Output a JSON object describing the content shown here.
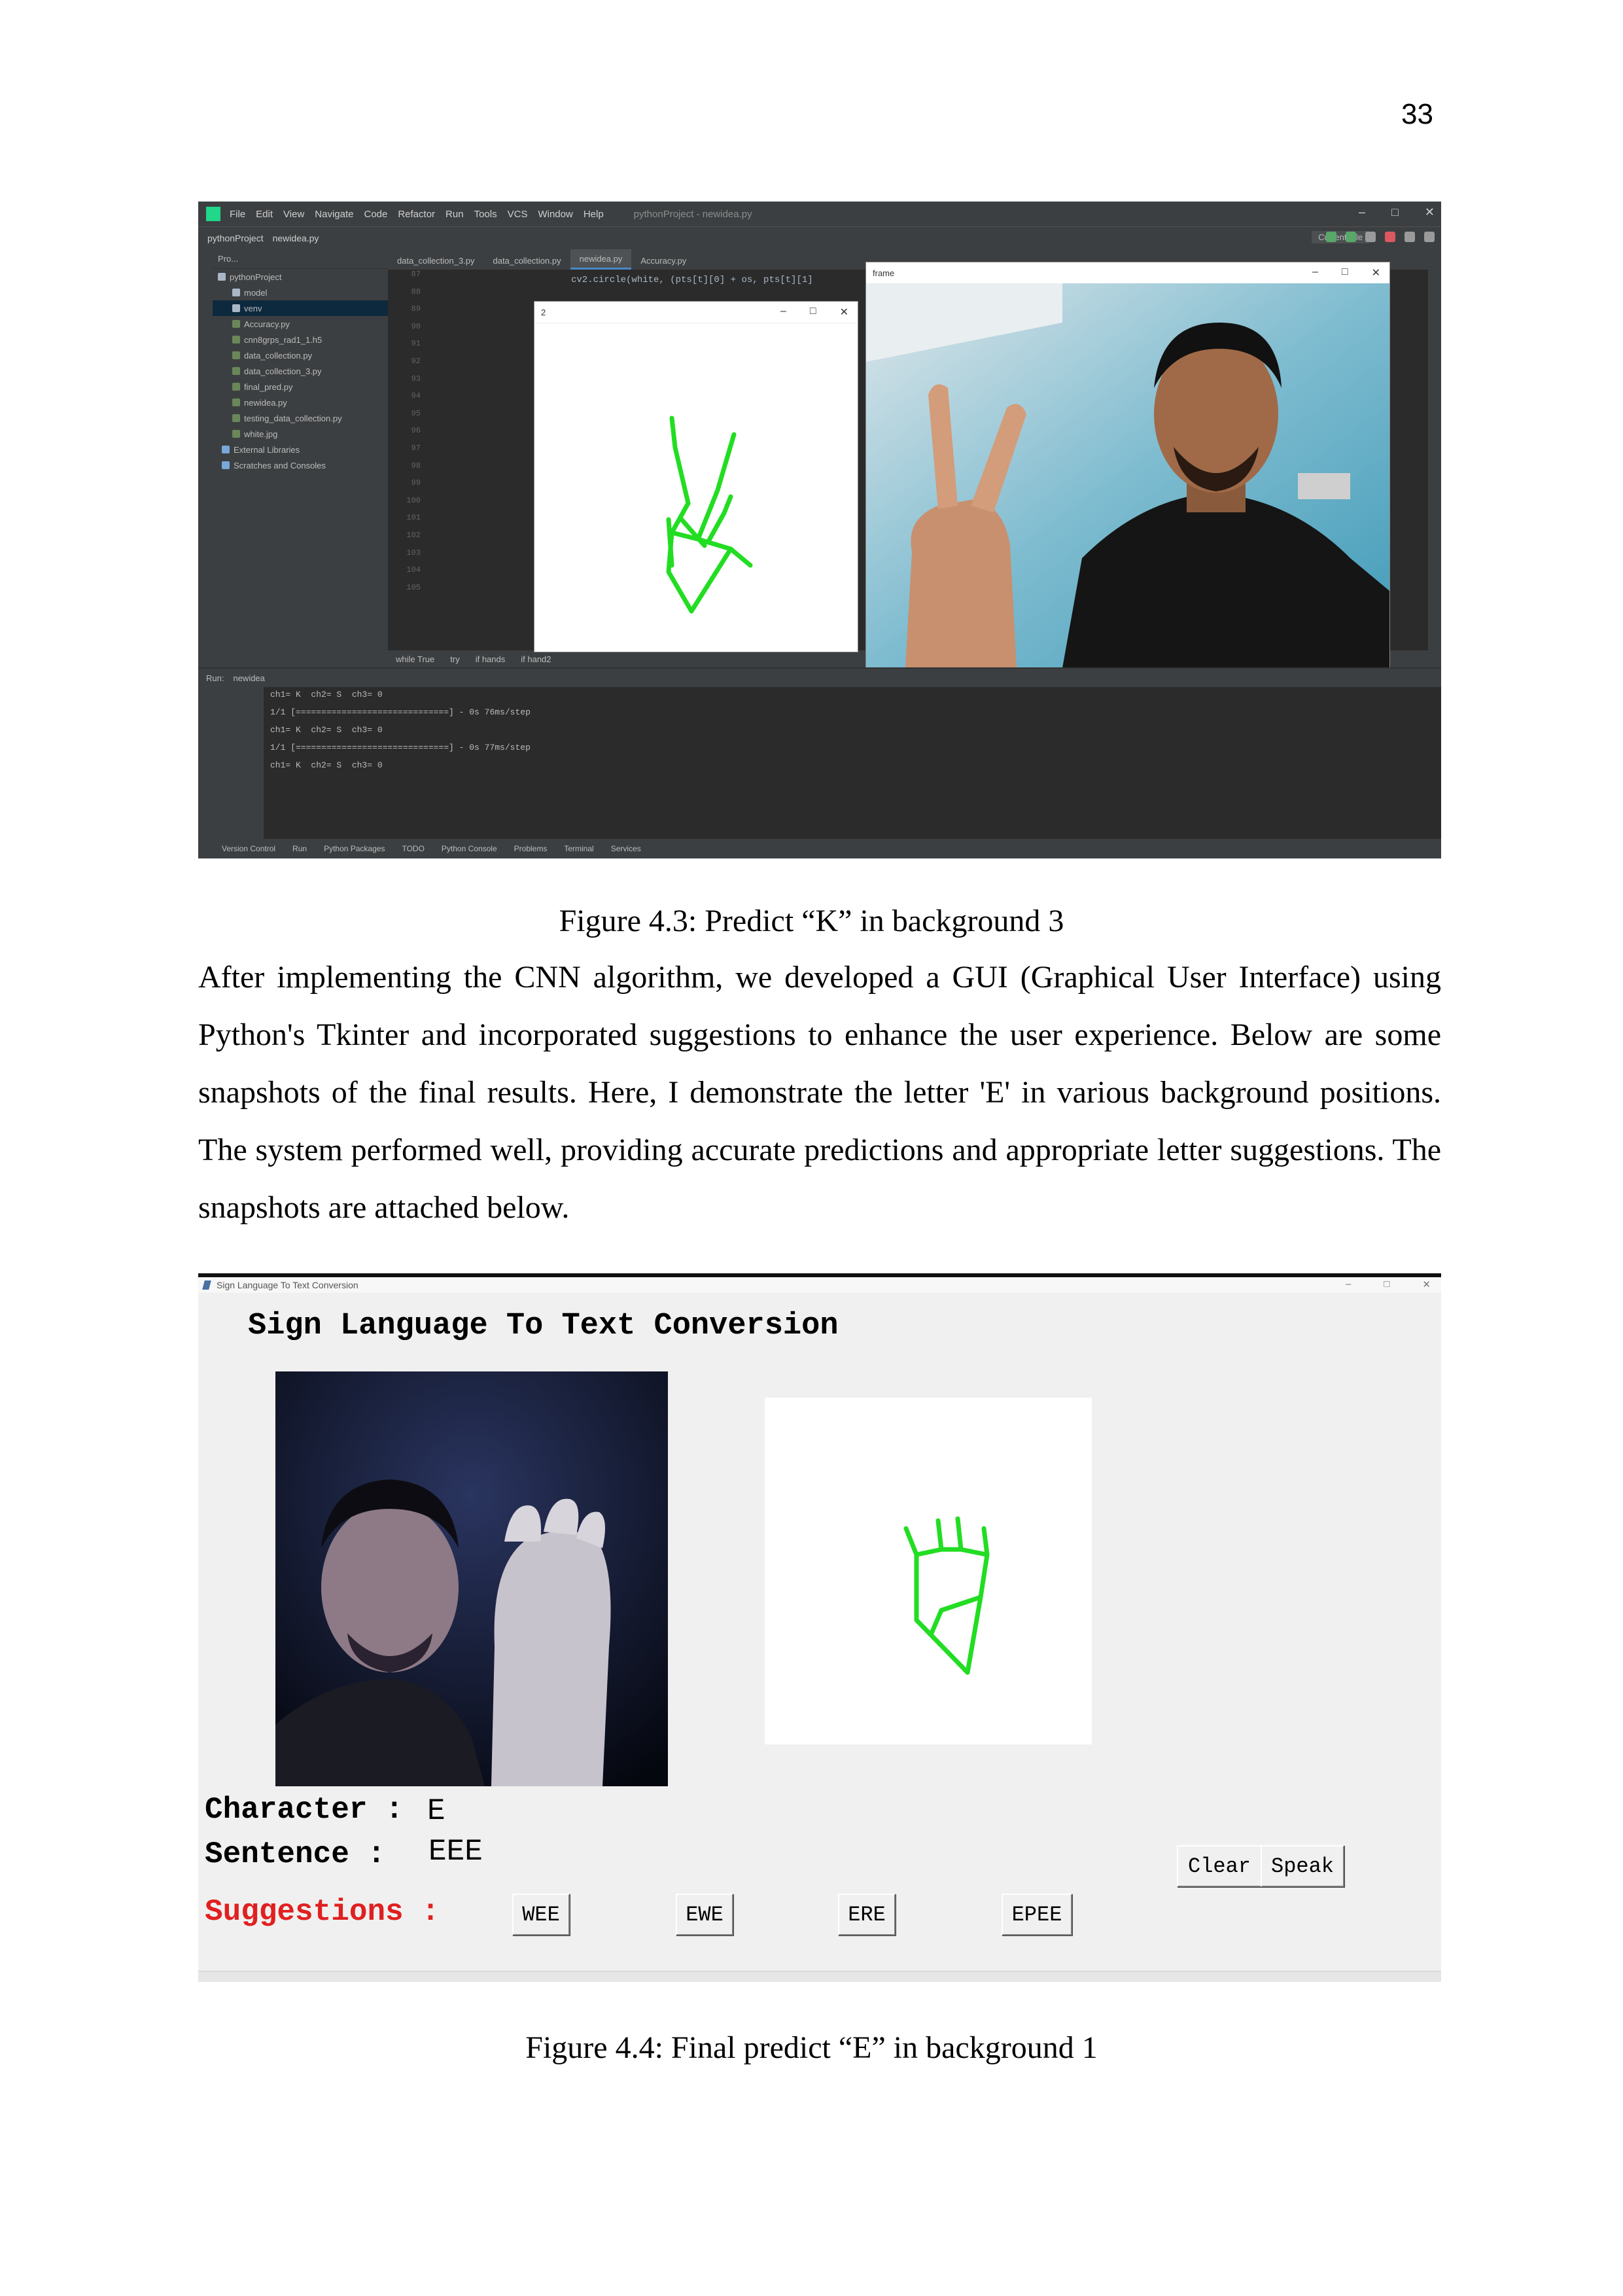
{
  "page": {
    "number": "33"
  },
  "figure_43": {
    "caption": "Figure 4.3: Predict “K” in background 3",
    "ide": {
      "menu": [
        "File",
        "Edit",
        "View",
        "Navigate",
        "Code",
        "Refactor",
        "Run",
        "Tools",
        "VCS",
        "Window",
        "Help"
      ],
      "window_title": "pythonProject - newidea.py",
      "breadcrumb": [
        "pythonProject",
        "newidea.py"
      ],
      "run_config": "Current File",
      "project_header": "Pro...",
      "tree": [
        {
          "label": "pythonProject",
          "kind": "folder"
        },
        {
          "label": "model",
          "kind": "folder"
        },
        {
          "label": "venv",
          "kind": "folder"
        },
        {
          "label": "Accuracy.py",
          "kind": "file"
        },
        {
          "label": "cnn8grps_rad1_1.h5",
          "kind": "file"
        },
        {
          "label": "data_collection.py",
          "kind": "file"
        },
        {
          "label": "data_collection_3.py",
          "kind": "file"
        },
        {
          "label": "final_pred.py",
          "kind": "file"
        },
        {
          "label": "newidea.py",
          "kind": "file"
        },
        {
          "label": "testing_data_collection.py",
          "kind": "file"
        },
        {
          "label": "white.jpg",
          "kind": "file"
        },
        {
          "label": "External Libraries",
          "kind": "lib"
        },
        {
          "label": "Scratches and Consoles",
          "kind": "lib"
        }
      ],
      "tabs": [
        "data_collection_3.py",
        "data_collection.py",
        "newidea.py",
        "Accuracy.py"
      ],
      "active_tab": 2,
      "line_numbers": [
        "87",
        "88",
        "89",
        "90",
        "91",
        "92",
        "93",
        "94",
        "95",
        "96",
        "97",
        "98",
        "99",
        "100",
        "101",
        "102",
        "103",
        "104",
        "105"
      ],
      "code_line": "cv2.circle(white, (pts[t][0] + os, pts[t][1]",
      "editor_breadcrumb": [
        "while True",
        "try",
        "if hands",
        "if hand2"
      ],
      "hand_window_title": "2",
      "frame_window_title": "frame",
      "run_tab": "newidea",
      "run_output": [
        "ch1= K  ch2= S  ch3= 0",
        "1/1 [==============================] - 0s 76ms/step",
        "ch1= K  ch2= S  ch3= 0",
        "1/1 [==============================] - 0s 77ms/step",
        "ch1= K  ch2= S  ch3= 0"
      ],
      "bottom_tabs": [
        "Version Control",
        "Run",
        "Python Packages",
        "TODO",
        "Python Console",
        "Problems",
        "Terminal",
        "Services"
      ]
    }
  },
  "paragraph": "After implementing the CNN algorithm, we developed a GUI (Graphical User Interface) using Python's Tkinter and incorporated suggestions to enhance the user experience. Below are some snapshots of the final results. Here, I demonstrate the letter 'E' in various background positions. The system performed well, providing accurate predictions and appropriate letter suggestions. The snapshots are attached below.",
  "figure_44": {
    "caption": "Figure 4.4: Final predict “E” in background 1",
    "gui": {
      "window_title": "Sign Language To Text Conversion",
      "heading": "Sign Language To Text Conversion",
      "character_label": "Character :",
      "character_value": "E",
      "sentence_label": "Sentence :",
      "sentence_value": "EEE",
      "suggestions_label": "Suggestions :",
      "suggestions": [
        "WEE",
        "EWE",
        "ERE",
        "EPEE"
      ],
      "clear_label": "Clear",
      "speak_label": "Speak",
      "suggestion_color": "#e02020"
    }
  },
  "colors": {
    "skeleton": "#22dd22",
    "ide_bg": "#2b2b2b"
  }
}
